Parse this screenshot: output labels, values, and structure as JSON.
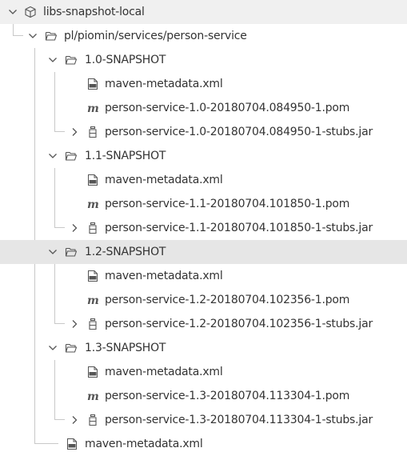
{
  "tree": {
    "root": {
      "label": "libs-snapshot-local",
      "icon": "repository-cube-icon",
      "expanded": true
    },
    "package": {
      "label": "pl/piomin/services/person-service",
      "icon": "folder-open-icon",
      "expanded": true
    },
    "versions": [
      {
        "label": "1.0-SNAPSHOT",
        "selected": false,
        "files": [
          {
            "label": "maven-metadata.xml",
            "icon": "xml-file-icon"
          },
          {
            "label": "person-service-1.0-20180704.084950-1.pom",
            "icon": "maven-pom-icon"
          },
          {
            "label": "person-service-1.0-20180704.084950-1-stubs.jar",
            "icon": "jar-archive-icon",
            "expandable": true
          }
        ]
      },
      {
        "label": "1.1-SNAPSHOT",
        "selected": false,
        "files": [
          {
            "label": "maven-metadata.xml",
            "icon": "xml-file-icon"
          },
          {
            "label": "person-service-1.1-20180704.101850-1.pom",
            "icon": "maven-pom-icon"
          },
          {
            "label": "person-service-1.1-20180704.101850-1-stubs.jar",
            "icon": "jar-archive-icon",
            "expandable": true
          }
        ]
      },
      {
        "label": "1.2-SNAPSHOT",
        "selected": true,
        "files": [
          {
            "label": "maven-metadata.xml",
            "icon": "xml-file-icon"
          },
          {
            "label": "person-service-1.2-20180704.102356-1.pom",
            "icon": "maven-pom-icon"
          },
          {
            "label": "person-service-1.2-20180704.102356-1-stubs.jar",
            "icon": "jar-archive-icon",
            "expandable": true
          }
        ]
      },
      {
        "label": "1.3-SNAPSHOT",
        "selected": false,
        "files": [
          {
            "label": "maven-metadata.xml",
            "icon": "xml-file-icon"
          },
          {
            "label": "person-service-1.3-20180704.113304-1.pom",
            "icon": "maven-pom-icon"
          },
          {
            "label": "person-service-1.3-20180704.113304-1-stubs.jar",
            "icon": "jar-archive-icon",
            "expandable": true
          }
        ]
      }
    ],
    "package_file": {
      "label": "maven-metadata.xml",
      "icon": "xml-file-icon"
    },
    "colors": {
      "text": "#333333",
      "icon": "#555555",
      "guide": "#c8c8c8",
      "selected_row": "#e6e6e6"
    }
  }
}
